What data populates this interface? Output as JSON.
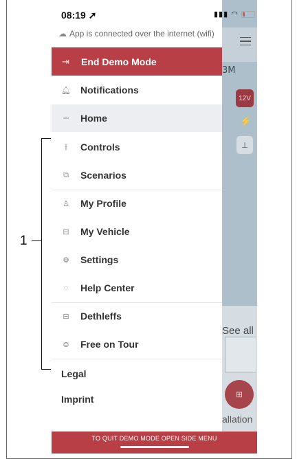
{
  "status_bar": {
    "time": "08:19 ➚",
    "signal_icons": "▮▮▮ ◠"
  },
  "connection": {
    "icon": "cloud-icon",
    "text": "App is connected over the internet (wifi)"
  },
  "demo_button": {
    "label": "End Demo Mode",
    "icon": "exit-icon"
  },
  "menu": {
    "items": [
      {
        "label": "Notifications",
        "icon": "bell-icon"
      },
      {
        "label": "Home",
        "icon": "grid-icon"
      },
      {
        "label": "Controls",
        "icon": "sliders-icon"
      },
      {
        "label": "Scenarios",
        "icon": "scenario-icon"
      },
      {
        "label": "My Profile",
        "icon": "user-icon"
      },
      {
        "label": "My Vehicle",
        "icon": "vehicle-icon"
      },
      {
        "label": "Settings",
        "icon": "gear-icon"
      },
      {
        "label": "Help Center",
        "icon": "headset-icon"
      },
      {
        "label": "Dethleffs",
        "icon": "vehicle-icon"
      },
      {
        "label": "Free on Tour",
        "icon": "tour-icon"
      }
    ],
    "footer_links": [
      "Legal",
      "Imprint"
    ]
  },
  "background": {
    "partial_heading": "3M",
    "badge_12v": "12V",
    "see_all": "See all",
    "installation": "allation"
  },
  "bottom_bar": {
    "text": "TO QUIT DEMO MODE OPEN SIDE MENU"
  },
  "annotation": {
    "number": "1"
  },
  "colors": {
    "accent": "#b83f45",
    "overlay": "#aebfcc"
  }
}
